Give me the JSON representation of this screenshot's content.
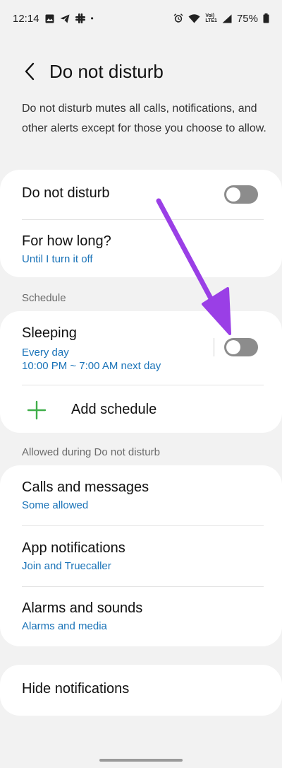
{
  "status_bar": {
    "time": "12:14",
    "dot": "•",
    "volte_top": "VoI)",
    "volte_bottom": "LTE1",
    "battery": "75%"
  },
  "header": {
    "back_icon": "chevron-left-icon",
    "title": "Do not disturb"
  },
  "description": "Do not disturb mutes all calls, notifications, and other alerts except for those you choose to allow.",
  "main_card": {
    "dnd_label": "Do not disturb",
    "dnd_enabled": false,
    "duration_label": "For how long?",
    "duration_value": "Until I turn it off"
  },
  "schedule": {
    "section_label": "Schedule",
    "sleeping_title": "Sleeping",
    "sleeping_days": "Every day",
    "sleeping_time": "10:00 PM ~ 7:00 AM next day",
    "sleeping_enabled": false,
    "add_label": "Add schedule"
  },
  "allowed": {
    "section_label": "Allowed during Do not disturb",
    "items": [
      {
        "title": "Calls and messages",
        "sub": "Some allowed"
      },
      {
        "title": "App notifications",
        "sub": "Join and Truecaller"
      },
      {
        "title": "Alarms and sounds",
        "sub": "Alarms and media"
      }
    ]
  },
  "hide_notifications": "Hide notifications",
  "colors": {
    "accent_link": "#1a73b8",
    "plus_green": "#3fae49",
    "arrow_purple": "#9a3fe6",
    "toggle_off": "#8c8c8c",
    "background": "#f2f2f2"
  }
}
